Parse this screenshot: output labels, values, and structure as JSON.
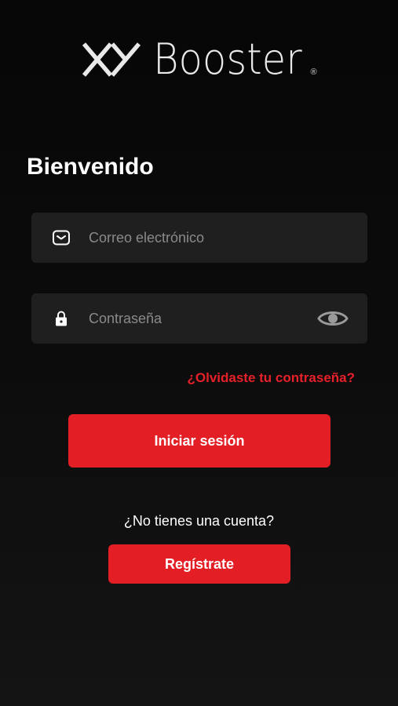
{
  "brand": {
    "logo_text": "Booster",
    "registered_mark": "®"
  },
  "login": {
    "title": "Bienvenido",
    "email": {
      "value": "",
      "placeholder": "Correo electrónico",
      "icon": "mail-icon"
    },
    "password": {
      "value": "",
      "placeholder": "Contraseña",
      "icon": "lock-icon",
      "toggle_icon": "eye-icon"
    },
    "forgot_password_label": "¿Olvidaste tu contraseña?",
    "submit_label": "Iniciar sesión",
    "no_account_text": "¿No tienes una cuenta?",
    "register_label": "Regístrate"
  },
  "colors": {
    "accent": "#e31e25",
    "field_background": "#1f1f1f",
    "background": "#0c0c0c"
  }
}
